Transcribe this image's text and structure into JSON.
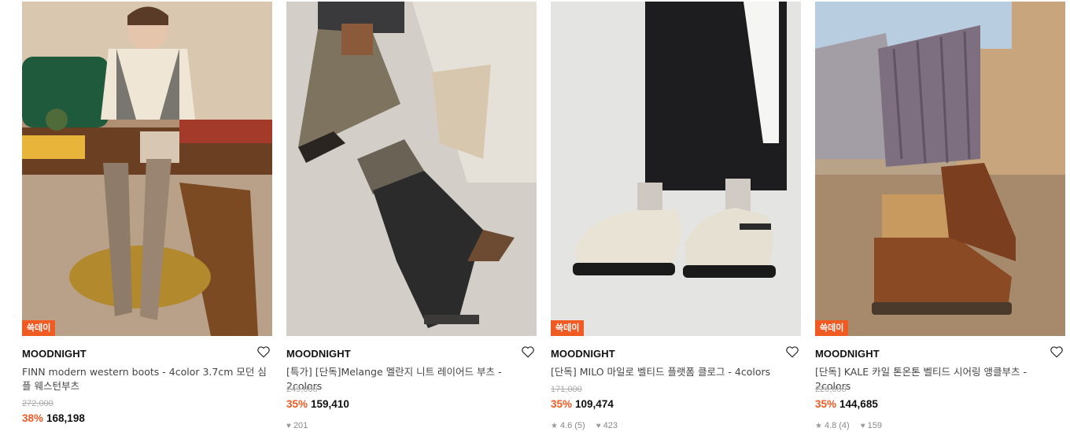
{
  "products": [
    {
      "badge": "쓱데이",
      "brand": "MOODNIGHT",
      "name": "FINN modern western boots - 4color 3.7cm 모던 심플 웨스턴부츠",
      "original_price": "272,000",
      "discount": "38%",
      "price": "168,198",
      "icon": "heart-outline-icon"
    },
    {
      "badge": "",
      "brand": "MOODNIGHT",
      "name": "[특가] [단독]Melange 멜란지 니트 레이어드 부츠 - 2colors",
      "original_price": "249,000",
      "discount": "35%",
      "price": "159,410",
      "likes": "201",
      "icon": "heart-outline-icon"
    },
    {
      "badge": "쓱데이",
      "brand": "MOODNIGHT",
      "name": "[단독] MILO 마일로 벨티드 플랫폼 클로그 - 4colors",
      "original_price": "171,000",
      "discount": "35%",
      "price": "109,474",
      "rating": "4.6",
      "reviews": "(5)",
      "likes": "423",
      "icon": "heart-outline-icon"
    },
    {
      "badge": "쓱데이",
      "brand": "MOODNIGHT",
      "name": "[단독] KALE 카일 톤온톤 벨티드 시어링 앵클부츠 - 2colors",
      "original_price": "226,000",
      "discount": "35%",
      "price": "144,685",
      "rating": "4.8",
      "reviews": "(4)",
      "likes": "159",
      "icon": "heart-outline-icon"
    }
  ],
  "colors": {
    "accent": "#f05a23",
    "strike": "#aaaaaa",
    "text": "#222222"
  }
}
